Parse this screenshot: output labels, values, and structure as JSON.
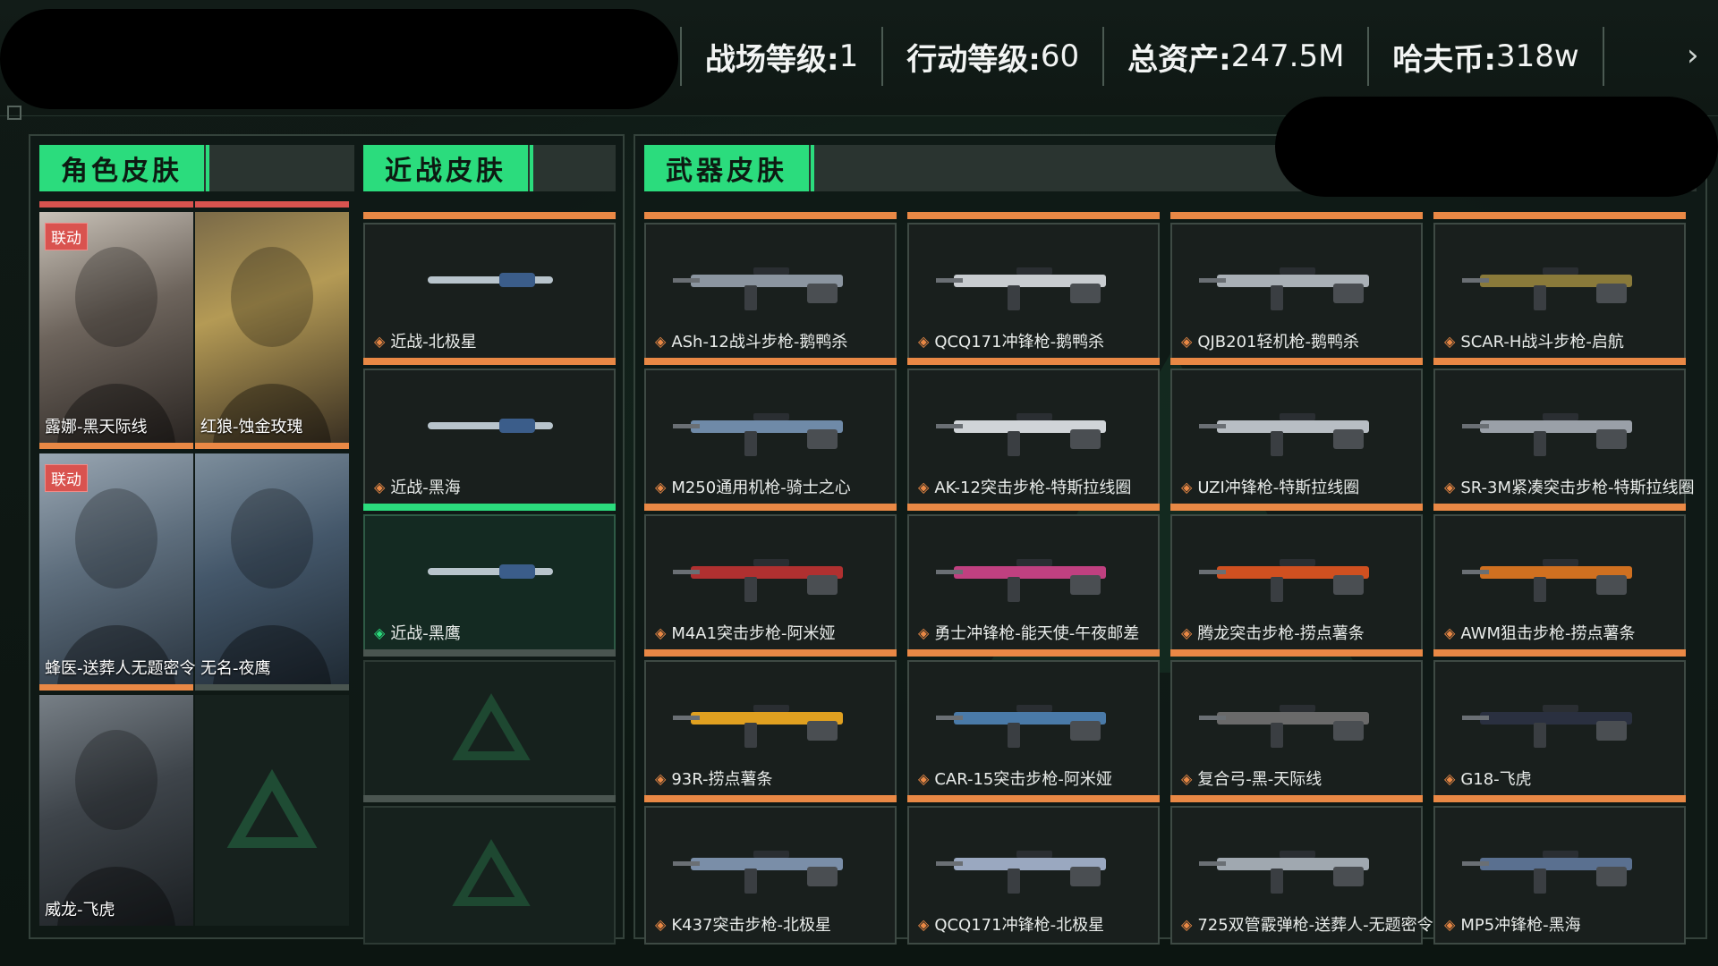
{
  "stats": [
    {
      "label": "战场等级:",
      "value": "1"
    },
    {
      "label": "行动等级:",
      "value": "60"
    },
    {
      "label": "总资产:",
      "value": "247.5M"
    },
    {
      "label": "哈夫币:",
      "value": "318w"
    }
  ],
  "sections": {
    "character": "角色皮肤",
    "melee": "近战皮肤",
    "weapon": "武器皮肤"
  },
  "characters": [
    {
      "name": "露娜-黑天际线",
      "badge": "联动"
    },
    {
      "name": "红狼-蚀金玫瑰",
      "badge": ""
    },
    {
      "name": "蜂医-送葬人无题密令",
      "badge": "联动"
    },
    {
      "name": "无名-夜鹰",
      "badge": ""
    },
    {
      "name": "威龙-飞虎",
      "badge": ""
    }
  ],
  "melee": [
    {
      "name": "近战-北极星"
    },
    {
      "name": "近战-黑海"
    },
    {
      "name": "近战-黑鹰"
    }
  ],
  "weapons": [
    {
      "name": "ASh-12战斗步枪-鹅鸭杀"
    },
    {
      "name": "QCQ171冲锋枪-鹅鸭杀"
    },
    {
      "name": "QJB201轻机枪-鹅鸭杀"
    },
    {
      "name": "SCAR-H战斗步枪-启航"
    },
    {
      "name": "M250通用机枪-骑士之心"
    },
    {
      "name": "AK-12突击步枪-特斯拉线圈"
    },
    {
      "name": "UZI冲锋枪-特斯拉线圈"
    },
    {
      "name": "SR-3M紧凑突击步枪-特斯拉线圈"
    },
    {
      "name": "M4A1突击步枪-阿米娅"
    },
    {
      "name": "勇士冲锋枪-能天使-午夜邮差"
    },
    {
      "name": "腾龙突击步枪-捞点薯条"
    },
    {
      "name": "AWM狙击步枪-捞点薯条"
    },
    {
      "name": "93R-捞点薯条"
    },
    {
      "name": "CAR-15突击步枪-阿米娅"
    },
    {
      "name": "复合弓-黑-天际线"
    },
    {
      "name": "G18-飞虎"
    },
    {
      "name": "K437突击步枪-北极星"
    },
    {
      "name": "QCQ171冲锋枪-北极星"
    },
    {
      "name": "725双管霰弹枪-送葬人-无题密令"
    },
    {
      "name": "MP5冲锋枪-黑海"
    }
  ],
  "colors": {
    "accent_green": "#2bdc7d",
    "rarity_orange": "#e98845",
    "collab_red": "#d9534f"
  }
}
